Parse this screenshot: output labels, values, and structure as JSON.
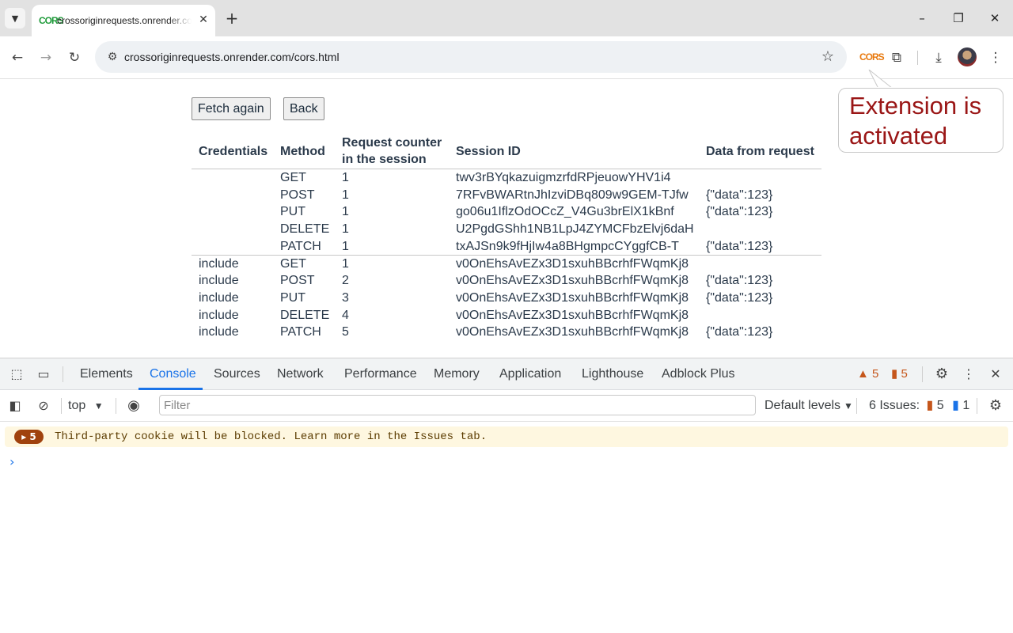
{
  "browser": {
    "tab": {
      "favicon_text": "CORS",
      "title": "crossoriginrequests.onrender.com/cors.html"
    },
    "url": "crossoriginrequests.onrender.com/cors.html",
    "extension_icon_text": "CORS"
  },
  "page": {
    "buttons": {
      "fetch_again": "Fetch again",
      "back": "Back"
    },
    "table": {
      "headers": {
        "credentials": "Credentials",
        "method": "Method",
        "counter_line1": "Request counter",
        "counter_line2": "in the session",
        "session_id": "Session ID",
        "data": "Data from request"
      },
      "rows": [
        {
          "credentials": "",
          "method": "GET",
          "counter": "1",
          "session_id": "twv3rBYqkazuigmzrfdRPjeuowYHV1i4",
          "data": ""
        },
        {
          "credentials": "",
          "method": "POST",
          "counter": "1",
          "session_id": "7RFvBWARtnJhIzviDBq809w9GEM-TJfw",
          "data": "{\"data\":123}"
        },
        {
          "credentials": "",
          "method": "PUT",
          "counter": "1",
          "session_id": "go06u1IflzOdOCcZ_V4Gu3brElX1kBnf",
          "data": "{\"data\":123}"
        },
        {
          "credentials": "",
          "method": "DELETE",
          "counter": "1",
          "session_id": "U2PgdGShh1NB1LpJ4ZYMCFbzElvj6daH",
          "data": ""
        },
        {
          "credentials": "",
          "method": "PATCH",
          "counter": "1",
          "session_id": "txAJSn9k9fHjIw4a8BHgmpcCYggfCB-T",
          "data": "{\"data\":123}"
        },
        {
          "credentials": "include",
          "method": "GET",
          "counter": "1",
          "session_id": "v0OnEhsAvEZx3D1sxuhBBcrhfFWqmKj8",
          "data": ""
        },
        {
          "credentials": "include",
          "method": "POST",
          "counter": "2",
          "session_id": "v0OnEhsAvEZx3D1sxuhBBcrhfFWqmKj8",
          "data": "{\"data\":123}"
        },
        {
          "credentials": "include",
          "method": "PUT",
          "counter": "3",
          "session_id": "v0OnEhsAvEZx3D1sxuhBBcrhfFWqmKj8",
          "data": "{\"data\":123}"
        },
        {
          "credentials": "include",
          "method": "DELETE",
          "counter": "4",
          "session_id": "v0OnEhsAvEZx3D1sxuhBBcrhfFWqmKj8",
          "data": ""
        },
        {
          "credentials": "include",
          "method": "PATCH",
          "counter": "5",
          "session_id": "v0OnEhsAvEZx3D1sxuhBBcrhfFWqmKj8",
          "data": "{\"data\":123}"
        }
      ]
    }
  },
  "annotation": {
    "tooltip_text": "Extension is activated"
  },
  "devtools": {
    "tabs": [
      "Elements",
      "Console",
      "Sources",
      "Network",
      "Performance",
      "Memory",
      "Application",
      "Lighthouse",
      "Adblock Plus"
    ],
    "active_tab": "Console",
    "warnings_count": "5",
    "errors_count": "5",
    "console": {
      "context": "top",
      "filter_placeholder": "Filter",
      "levels": "Default levels",
      "issues_label": "6 Issues:",
      "issues_warnings": "5",
      "issues_info": "1",
      "message_count": "5",
      "message": "Third-party cookie will be blocked. Learn more in the Issues tab."
    }
  },
  "colors": {
    "accent": "#1a73e8",
    "tooltip_text": "#9a1616",
    "warning_bg": "#fef7e0",
    "warning_badge": "#a0420e"
  }
}
